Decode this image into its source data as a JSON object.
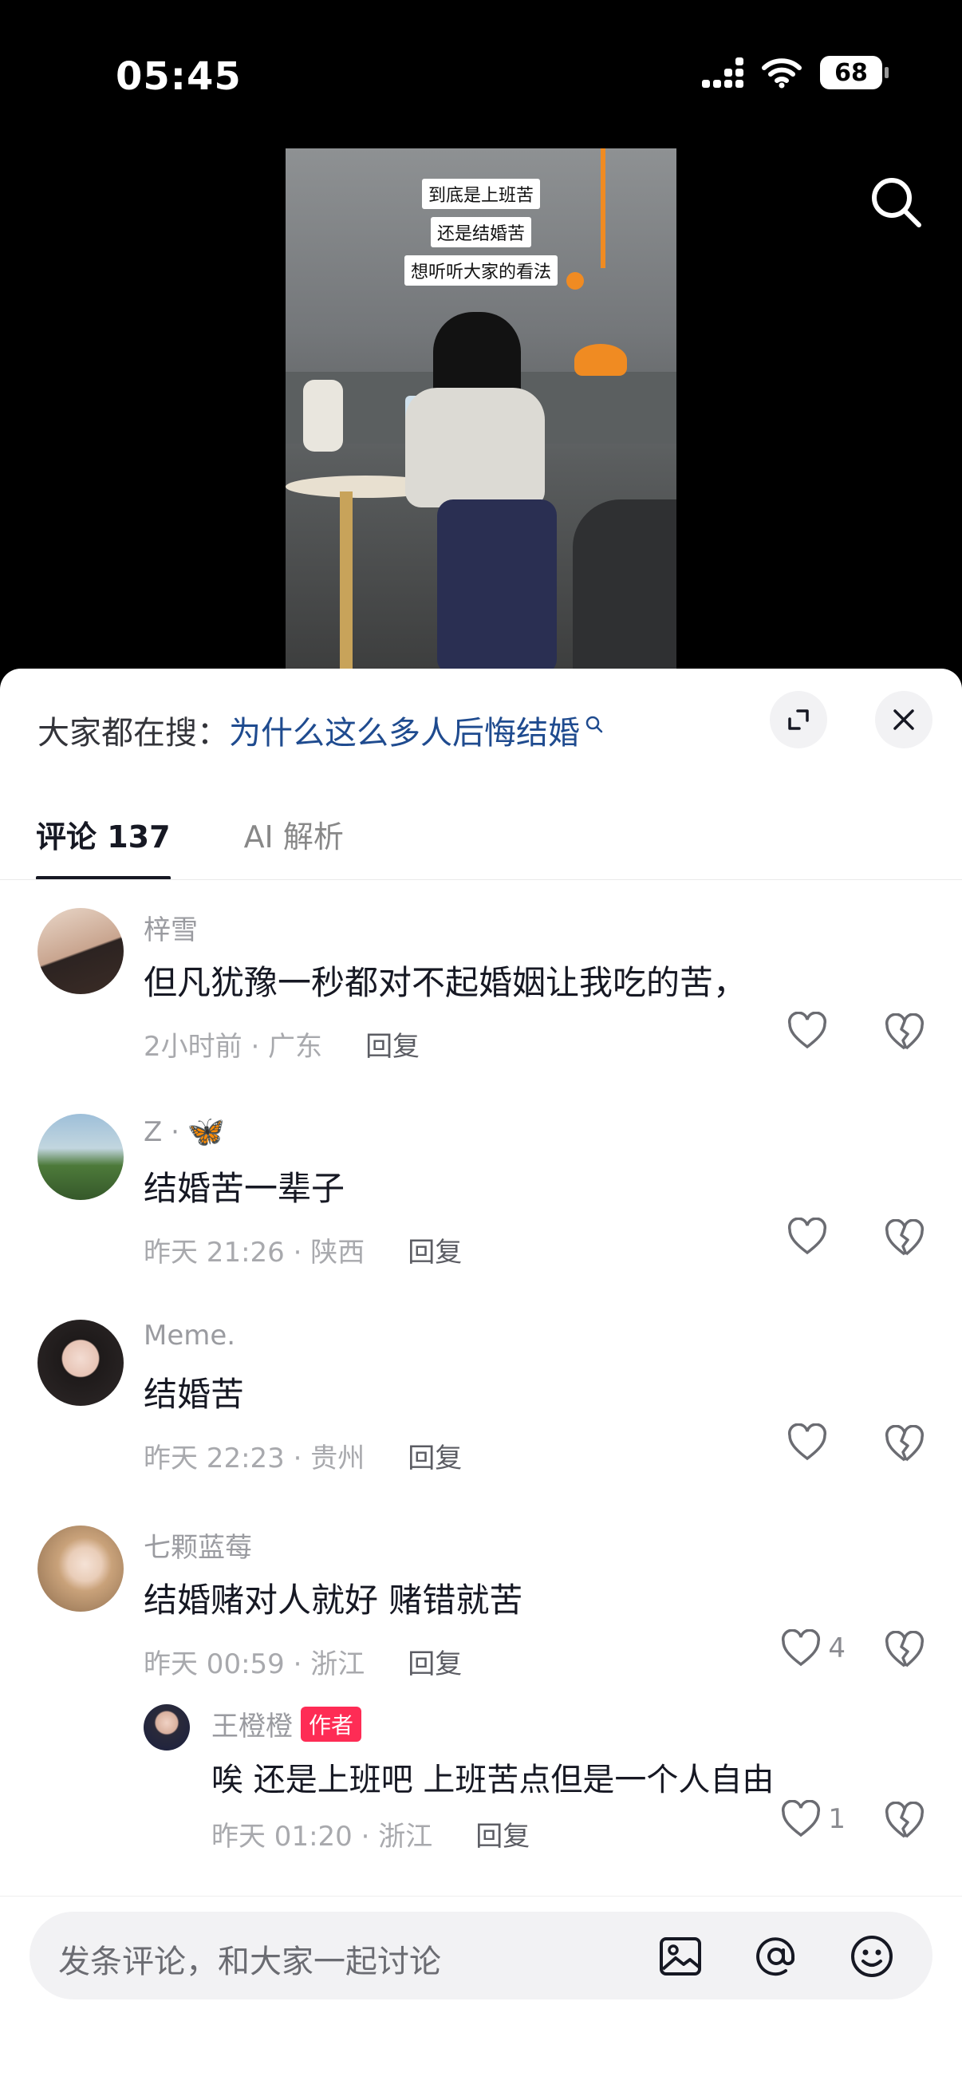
{
  "status": {
    "time": "05:45",
    "battery": "68"
  },
  "video": {
    "captions": [
      "到底是上班苦",
      "还是结婚苦",
      "想听听大家的看法"
    ]
  },
  "hot_search": {
    "label": "大家都在搜：",
    "term": "为什么这么多人后悔结婚"
  },
  "tabs": [
    {
      "label": "评论 137"
    },
    {
      "label": "AI 解析"
    }
  ],
  "comments": [
    {
      "name": "梓雪",
      "text": "但凡犹豫一秒都对不起婚姻让我吃的苦，",
      "time": "2小时前 · 广东",
      "reply": "回复",
      "likes": ""
    },
    {
      "name": "Z ·",
      "text": "结婚苦一辈子",
      "time": "昨天 21:26 · 陕西",
      "reply": "回复",
      "likes": ""
    },
    {
      "name": "Meme.",
      "text": "结婚苦",
      "time": "昨天 22:23 · 贵州",
      "reply": "回复",
      "likes": ""
    },
    {
      "name": "七颗蓝莓",
      "text": "结婚赌对人就好 赌错就苦",
      "time": "昨天 00:59 · 浙江",
      "reply": "回复",
      "likes": "4"
    }
  ],
  "author_reply": {
    "name": "王橙橙",
    "badge": "作者",
    "text": "唉 还是上班吧 上班苦点但是一个人自由",
    "time": "昨天 01:20 · 浙江",
    "reply": "回复",
    "likes": "1"
  },
  "input": {
    "placeholder": "发条评论，和大家一起讨论"
  },
  "icons": {
    "search": "search-icon",
    "expand": "expand-icon",
    "close": "close-icon",
    "like": "heart-icon",
    "dislike": "broken-heart-icon",
    "image": "image-icon",
    "mention": "at-icon",
    "emoji": "emoji-icon"
  }
}
